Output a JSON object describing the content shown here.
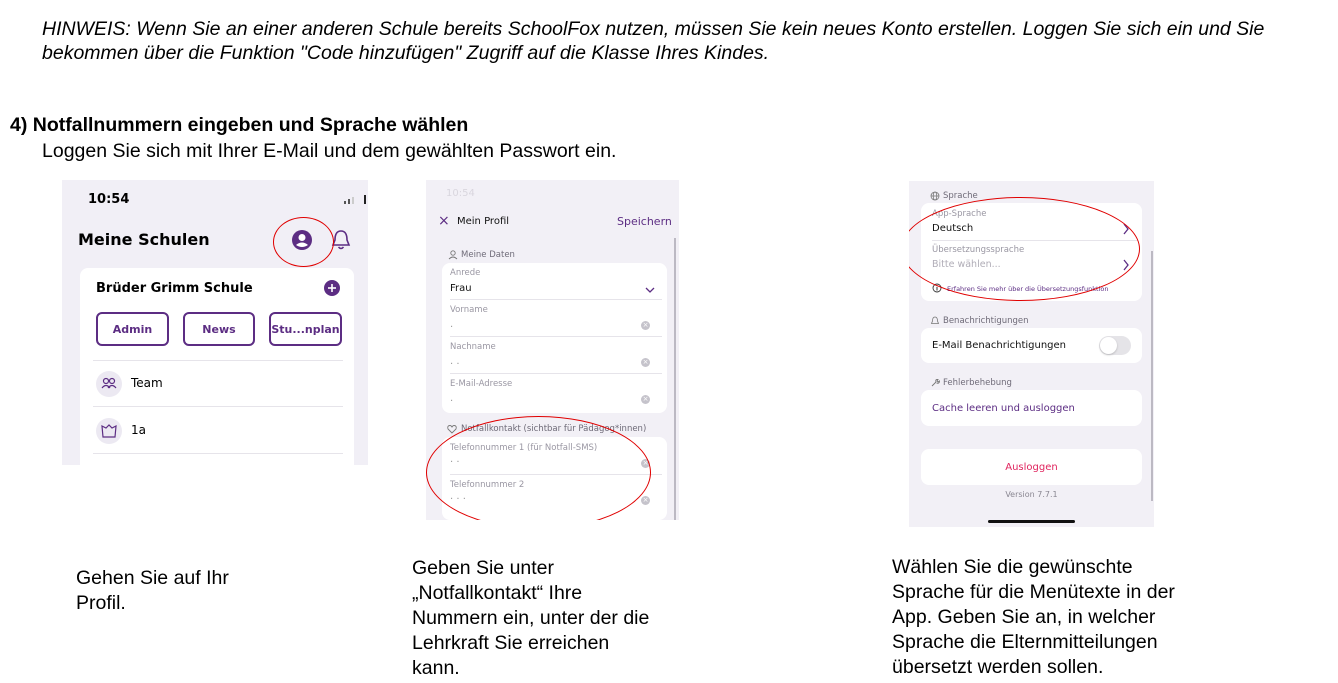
{
  "hint": "HINWEIS: Wenn Sie an einer anderen Schule bereits SchoolFox nutzen, müssen Sie kein neues Konto erstellen. Loggen Sie sich ein und Sie bekommen über die Funktion \"Code hinzufügen\" Zugriff auf die Klasse Ihres Kindes.",
  "step": {
    "title": "4)  Notfallnummern eingeben und Sprache wählen",
    "subtitle": "Loggen Sie sich mit Ihrer E-Mail und dem gewählten Passwort ein."
  },
  "shot1": {
    "time": "10:54",
    "title": "Meine Schulen",
    "school": "Brüder Grimm Schule",
    "buttons": [
      "Admin",
      "News",
      "Stu...nplan"
    ],
    "items": [
      "Team",
      "1a"
    ]
  },
  "shot2": {
    "time": "10:54",
    "close": "×",
    "title": "Mein Profil",
    "save": "Speichern",
    "section1": "Meine Daten",
    "anrede_label": "Anrede",
    "anrede_value": "Frau",
    "vorname_label": "Vorname",
    "vorname_value": ".",
    "nachname_label": "Nachname",
    "nachname_value": ".         .",
    "email_label": "E-Mail-Adresse",
    "email_value": ".",
    "section2": "Notfallkontakt (sichtbar für Pädagog*innen)",
    "tel1_label": "Telefonnummer 1 (für Notfall-SMS)",
    "tel1_value": "· ·",
    "tel2_label": "Telefonnummer 2",
    "tel2_value": "·  ·  ·"
  },
  "shot3": {
    "section_lang": "Sprache",
    "app_lang_label": "App-Sprache",
    "app_lang_value": "Deutsch",
    "trans_label": "Übersetzungssprache",
    "trans_placeholder": "Bitte wählen...",
    "info": "Erfahren Sie mehr über die Übersetzungsfunktion",
    "section_notif": "Benachrichtigungen",
    "email_notif": "E-Mail Benachrichtigungen",
    "section_err": "Fehlerbehebung",
    "cache": "Cache leeren und ausloggen",
    "logout": "Ausloggen",
    "version": "Version 7.7.1"
  },
  "captions": {
    "c1": [
      "Gehen Sie auf Ihr",
      "Profil."
    ],
    "c2": [
      "Geben Sie unter",
      "„Notfallkontakt“ Ihre",
      "Nummern ein, unter der die",
      "Lehrkraft Sie erreichen",
      "kann."
    ],
    "c3": [
      "Wählen Sie die gewünschte",
      "Sprache für die Menütexte in der",
      "App. Geben Sie an, in welcher",
      "Sprache die Elternmitteilungen",
      "übersetzt werden sollen."
    ]
  },
  "colors": {
    "accent": "#5c2d83",
    "highlight": "#e00000",
    "logout": "#e0245e"
  }
}
